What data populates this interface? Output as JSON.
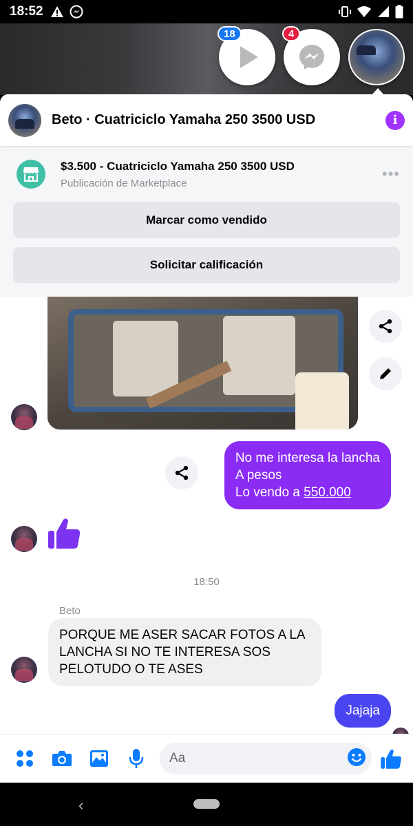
{
  "status_bar": {
    "time": "18:52",
    "left_icons": [
      "warning-icon",
      "messenger-icon"
    ],
    "right_icons": [
      "vibrate-icon",
      "wifi-icon",
      "signal-icon",
      "battery-icon"
    ]
  },
  "chat_heads": [
    {
      "name": "video-chathead",
      "badge": "18",
      "icon": "play-icon"
    },
    {
      "name": "messenger-chathead",
      "badge": "4",
      "icon": "messenger-icon"
    },
    {
      "name": "atv-chathead",
      "badge": "",
      "icon": "atv-avatar"
    }
  ],
  "header": {
    "title": "Beto · Cuatriciclo Yamaha 250 3500 USD",
    "info_icon": "info-icon"
  },
  "listing": {
    "title": "$3.500 - Cuatriciclo Yamaha 250 3500 USD",
    "subtitle": "Publicación de Marketplace",
    "more": "•••",
    "mark_sold_label": "Marcar como vendido",
    "request_rating_label": "Solicitar calificación"
  },
  "messages": {
    "outgoing_1_lines": [
      "No me interesa la lancha",
      "A pesos",
      "Lo vendo a "
    ],
    "outgoing_1_link": "550.000",
    "timestamp": "18:50",
    "sender_name": "Beto",
    "incoming_text": "PORQUE ME ASER SACAR FOTOS A LA LANCHA SI NO TE INTERESA SOS PELOTUDO O TE ASES",
    "outgoing_2": "Jajaja"
  },
  "composer": {
    "placeholder": "Aa",
    "icons": [
      "menu-dots-icon",
      "camera-icon",
      "gallery-icon",
      "microphone-icon",
      "emoji-icon",
      "thumbs-up-icon"
    ]
  },
  "colors": {
    "accent_purple": "#8a2cf4",
    "accent_blue": "#4a45f0",
    "messenger_blue": "#1877f2",
    "info_purple": "#a033ff"
  }
}
